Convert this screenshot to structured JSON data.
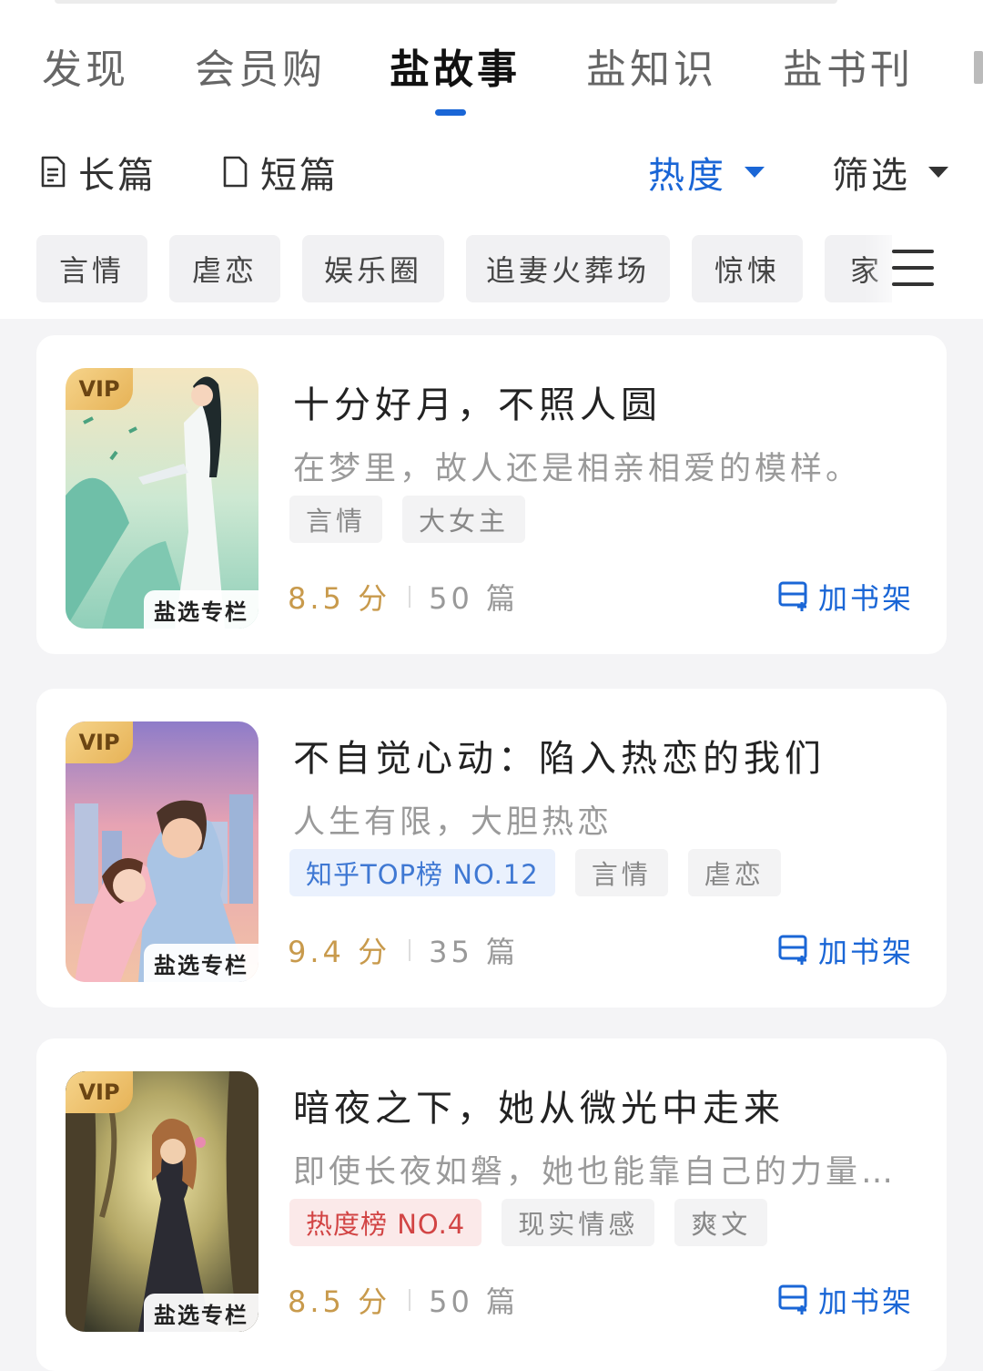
{
  "tabs": [
    {
      "label": "发现"
    },
    {
      "label": "会员购"
    },
    {
      "label": "盐故事"
    },
    {
      "label": "盐知识"
    },
    {
      "label": "盐书刊"
    }
  ],
  "active_tab": "盐故事",
  "sub_filters": {
    "long": "长篇",
    "short": "短篇",
    "sort": "热度",
    "filter": "筛选"
  },
  "categories": [
    "言情",
    "虐恋",
    "娱乐圈",
    "追妻火葬场",
    "惊悚",
    "家"
  ],
  "colors": {
    "accent": "#1a66d6",
    "score": "#c89a4c",
    "rank_blue": "#3f78d3",
    "rank_red": "#d24444"
  },
  "books": [
    {
      "vip": "VIP",
      "column_tag": "盐选专栏",
      "title": "十分好月，不照人圆",
      "desc": "在梦里，故人还是相亲相爱的模样。",
      "tags": [
        {
          "text": "言情",
          "style": "normal"
        },
        {
          "text": "大女主",
          "style": "normal"
        }
      ],
      "score": "8.5 分",
      "count": "50 篇",
      "action": "加书架"
    },
    {
      "vip": "VIP",
      "column_tag": "盐选专栏",
      "title": "不自觉心动：陷入热恋的我们",
      "desc": "人生有限，大胆热恋",
      "tags": [
        {
          "text": "知乎TOP榜 NO.12",
          "style": "blue"
        },
        {
          "text": "言情",
          "style": "normal"
        },
        {
          "text": "虐恋",
          "style": "normal"
        }
      ],
      "score": "9.4 分",
      "count": "35 篇",
      "action": "加书架"
    },
    {
      "vip": "VIP",
      "column_tag": "盐选专栏",
      "title": "暗夜之下，她从微光中走来",
      "desc": "即使长夜如磐，她也能靠自己的力量窥...",
      "tags": [
        {
          "text": "热度榜 NO.4",
          "style": "red"
        },
        {
          "text": "现实情感",
          "style": "normal"
        },
        {
          "text": "爽文",
          "style": "normal"
        }
      ],
      "score": "8.5 分",
      "count": "50 篇",
      "action": "加书架"
    }
  ]
}
